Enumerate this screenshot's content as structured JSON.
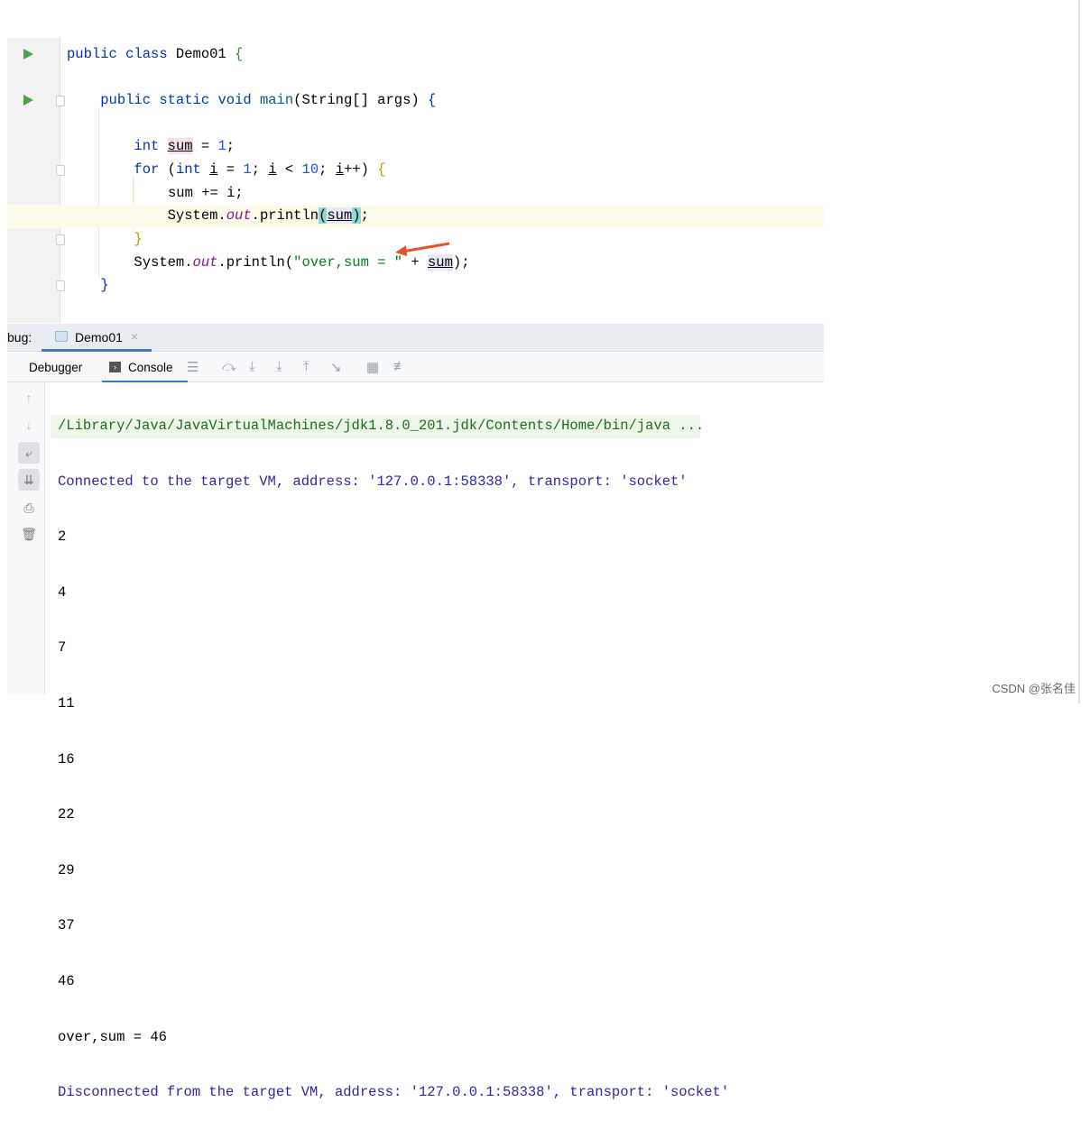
{
  "editor": {
    "lines": [
      {
        "text": "public class Demo01 {"
      },
      {
        "text": ""
      },
      {
        "text": "public static void main(String[] args) {"
      },
      {
        "text": ""
      },
      {
        "text": "int sum = 1;"
      },
      {
        "text": "for (int i = 1; i < 10; i++) {"
      },
      {
        "text": "sum += i;"
      },
      {
        "text": "System.out.println(sum);"
      },
      {
        "text": "}"
      },
      {
        "text": "System.out.println(\"over,sum = \" + sum);"
      },
      {
        "text": "}"
      }
    ],
    "current_line_highlight": "#fcfbea",
    "annotation_arrow_color": "#e8502a"
  },
  "debug": {
    "label": "bug:",
    "tab": "Demo01",
    "toolbar": {
      "debugger": "Debugger",
      "console": "Console"
    },
    "accent": "#3d7ac8"
  },
  "console": {
    "lines": [
      "/Library/Java/JavaVirtualMachines/jdk1.8.0_201.jdk/Contents/Home/bin/java ...",
      "Connected to the target VM, address: '127.0.0.1:58338', transport: 'socket'",
      "2",
      "4",
      "7",
      "11",
      "16",
      "22",
      "29",
      "37",
      "46",
      "over,sum = 46",
      "Disconnected from the target VM, address: '127.0.0.1:58338', transport: 'socket'"
    ]
  },
  "watermark": "CSDN @张名佳"
}
